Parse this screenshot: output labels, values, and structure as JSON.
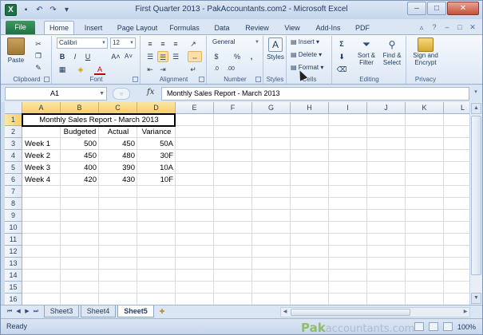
{
  "window": {
    "title": "First Quarter 2013 - PakAccountants.com2 - Microsoft Excel",
    "app_icon": "X"
  },
  "ribbon_tabs": [
    "File",
    "Home",
    "Insert",
    "Page Layout",
    "Formulas",
    "Data",
    "Review",
    "View",
    "Add-Ins",
    "PDF"
  ],
  "active_tab": "Home",
  "ribbon": {
    "clipboard": {
      "label": "Clipboard",
      "paste": "Paste"
    },
    "font": {
      "label": "Font",
      "name": "Calibri",
      "size": "12",
      "bold": "B",
      "italic": "I",
      "underline": "U"
    },
    "alignment": {
      "label": "Alignment"
    },
    "number": {
      "label": "Number",
      "format": "General",
      "currency": "$",
      "percent": "%",
      "comma": ","
    },
    "styles": {
      "label": "Styles",
      "button": "Styles"
    },
    "cells": {
      "label": "Cells",
      "insert": "Insert",
      "delete": "Delete",
      "format": "Format"
    },
    "editing": {
      "label": "Editing",
      "sigma": "Σ",
      "sort_filter_1": "Sort &",
      "sort_filter_2": "Filter",
      "find_select_1": "Find &",
      "find_select_2": "Select"
    },
    "privacy": {
      "label": "Privacy",
      "sign_1": "Sign and",
      "sign_2": "Encrypt"
    }
  },
  "formula_bar": {
    "name_box": "A1",
    "fx": "fx",
    "value": "Monthly Sales Report - March 2013"
  },
  "columns": [
    "A",
    "B",
    "C",
    "D",
    "E",
    "F",
    "G",
    "H",
    "I",
    "J",
    "K",
    "L"
  ],
  "rows": [
    "1",
    "2",
    "3",
    "4",
    "5",
    "6",
    "7",
    "8",
    "9",
    "10",
    "11",
    "12",
    "13",
    "14",
    "15",
    "16"
  ],
  "sheet": {
    "title": "Monthly Sales Report - March 2013",
    "headers": [
      "Budgeted",
      "Actual",
      "Variance"
    ],
    "data": [
      {
        "week": "Week 1",
        "budgeted": "500",
        "actual": "450",
        "variance": "50A"
      },
      {
        "week": "Week 2",
        "budgeted": "450",
        "actual": "480",
        "variance": "30F"
      },
      {
        "week": "Week 3",
        "budgeted": "400",
        "actual": "390",
        "variance": "10A"
      },
      {
        "week": "Week 4",
        "budgeted": "420",
        "actual": "430",
        "variance": "10F"
      }
    ]
  },
  "sheet_tabs": [
    "Sheet3",
    "Sheet4",
    "Sheet5"
  ],
  "active_sheet": "Sheet5",
  "status": {
    "mode": "Ready",
    "zoom": "100%",
    "watermark_1": "Pak",
    "watermark_2": "accountants.com"
  },
  "colors": {
    "file_tab": "#1e7145",
    "selection_header": "#f8cf6c",
    "ribbon_bg": "#dde8f5"
  }
}
